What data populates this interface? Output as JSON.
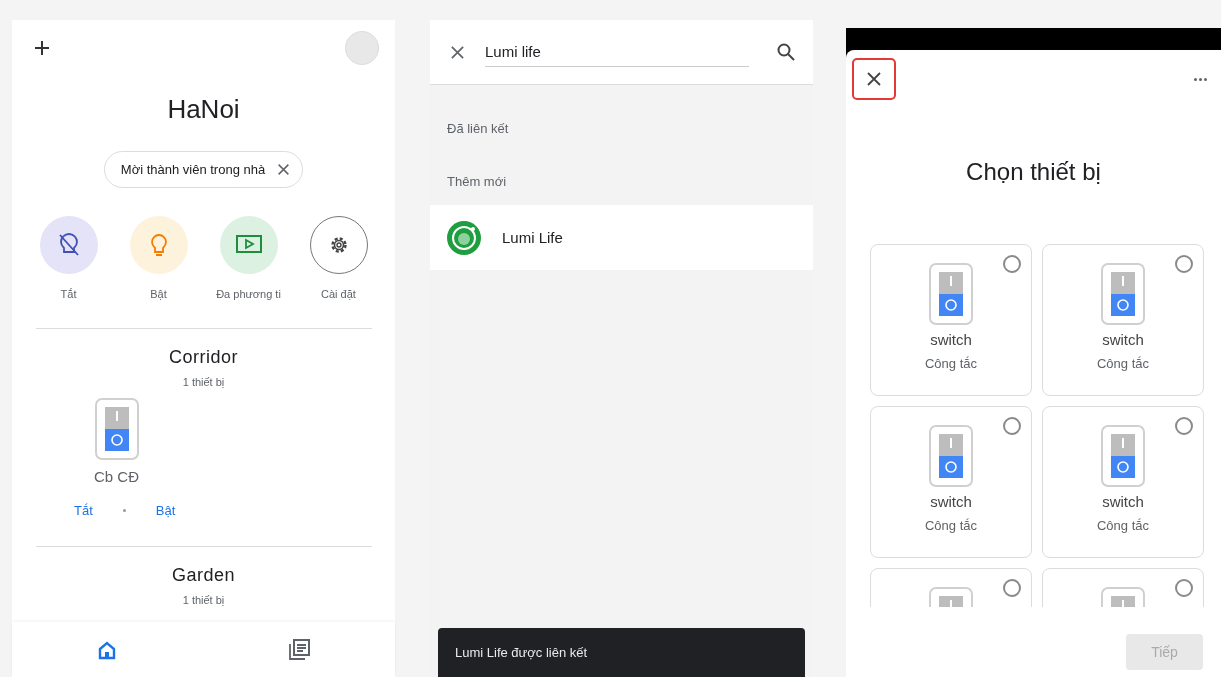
{
  "home_screen": {
    "title": "HaNoi",
    "invite_chip": "Mời thành viên trong nhà",
    "shortcuts": [
      {
        "kind": "off",
        "label": "Tắt"
      },
      {
        "kind": "on",
        "label": "Bật"
      },
      {
        "kind": "media",
        "label": "Đa phương ti"
      },
      {
        "kind": "settings",
        "label": "Cài đặt"
      }
    ],
    "rooms": [
      {
        "name": "Corridor",
        "count": "1 thiết bị",
        "devices": [
          {
            "name": "Cb CĐ"
          }
        ],
        "actions": [
          "Tắt",
          "Bật"
        ]
      },
      {
        "name": "Garden",
        "count": "1 thiết bị"
      }
    ],
    "nav": [
      {
        "kind": "home",
        "selected": true
      },
      {
        "kind": "feed",
        "selected": false
      }
    ]
  },
  "search_screen": {
    "query": "Lumi life",
    "linked_label": "Đã liên kết",
    "new_label": "Thêm mới",
    "results": [
      {
        "name": "Lumi Life"
      }
    ],
    "snackbar": "Lumi Life được liên kết"
  },
  "device_picker": {
    "close_highlighted": true,
    "title": "Chọn thiết bị",
    "devices": [
      {
        "name": "switch",
        "type": "Công tắc",
        "selected": false
      },
      {
        "name": "switch",
        "type": "Công tắc",
        "selected": false
      },
      {
        "name": "switch",
        "type": "Công tắc",
        "selected": false
      },
      {
        "name": "switch",
        "type": "Công tắc",
        "selected": false
      },
      {
        "selected": false
      },
      {
        "selected": false
      }
    ],
    "next_button": {
      "label": "Tiếp",
      "disabled": true
    }
  }
}
